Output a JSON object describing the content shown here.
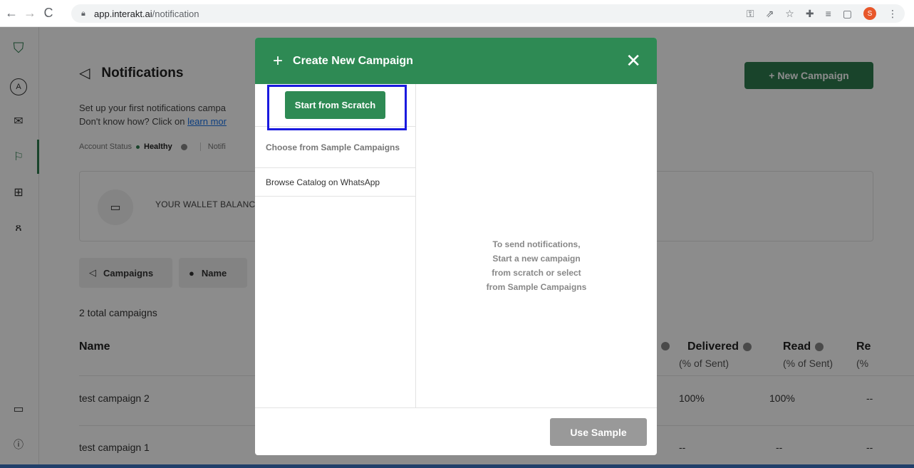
{
  "browser": {
    "url_host": "app.interakt.ai",
    "url_path": "/notification",
    "profile_initial": "S"
  },
  "page": {
    "title": "Notifications",
    "intro_line1": "Set up your first notifications campa",
    "intro_line2": "Don't know how? Click on ",
    "learn_more": "learn mor",
    "account_status_label": "Account Status",
    "account_status_value": "Healthy",
    "notif_partial": "Notifi",
    "new_campaign": "+ New Campaign",
    "wallet_label": "YOUR WALLET BALANC",
    "filters": [
      {
        "label": "Campaigns"
      },
      {
        "label": "Name"
      }
    ],
    "total_campaigns": "2 total campaigns",
    "table": {
      "col_name": "Name",
      "col_delivered": "Delivered",
      "col_delivered_sub": "(% of Sent)",
      "col_read": "Read",
      "col_read_sub": "(% of Sent)",
      "col_rep": "Re",
      "col_rep_sub": "(%",
      "rows": [
        {
          "name": "test campaign 2",
          "delivered": "100%",
          "read": "100%",
          "rep": "--"
        },
        {
          "name": "test campaign 1",
          "delivered": "--",
          "read": "--",
          "rep": "--"
        }
      ]
    }
  },
  "modal": {
    "title": "Create New Campaign",
    "start_scratch": "Start from Scratch",
    "sample_campaigns": "Choose from Sample Campaigns",
    "browse_catalog": "Browse Catalog on WhatsApp",
    "message_lines": [
      "To send notifications,",
      "Start a new campaign",
      "from scratch or select",
      "from Sample Campaigns"
    ],
    "use_sample": "Use Sample"
  },
  "colors": {
    "brand_green": "#2e8a54",
    "highlight_blue": "#1a1adf"
  }
}
